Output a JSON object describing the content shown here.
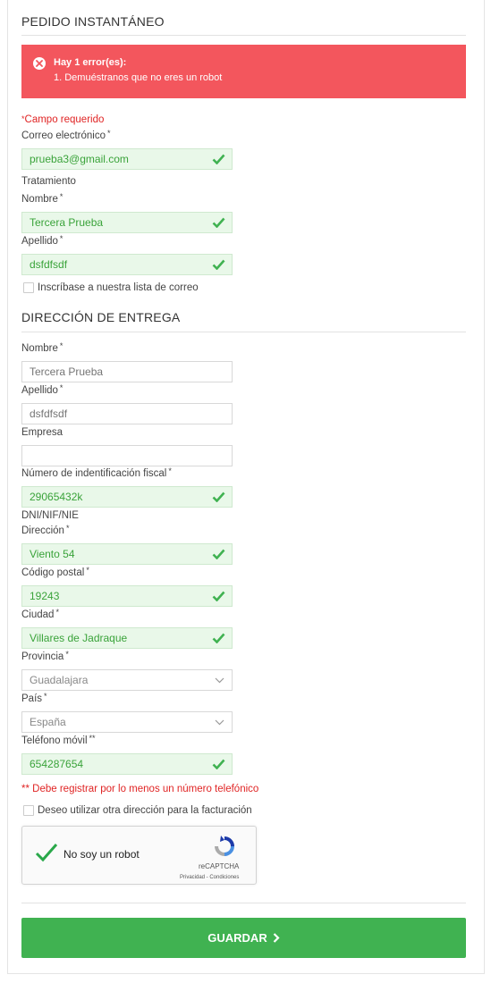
{
  "form": {
    "title": "PEDIDO INSTANTÁNEO",
    "alert": {
      "title": "Hay 1 error(es):",
      "message": "1. Demuéstranos que no eres un robot",
      "color": "#f3565d"
    },
    "required_note": "Campo requerido",
    "email": {
      "label": "Correo electrónico",
      "value": "prueba3@gmail.com"
    },
    "tratamiento_label": "Tratamiento",
    "first_name": {
      "label": "Nombre",
      "value": "Tercera Prueba"
    },
    "last_name": {
      "label": "Apellido",
      "value": "dsfdfsdf"
    },
    "newsletter_label": "Inscríbase a nuestra lista de correo"
  },
  "delivery": {
    "title": "DIRECCIÓN DE ENTREGA",
    "first_name": {
      "label": "Nombre",
      "placeholder": "Tercera Prueba"
    },
    "last_name": {
      "label": "Apellido",
      "placeholder": "dsfdfsdf"
    },
    "company": {
      "label": "Empresa",
      "value": ""
    },
    "tax_id": {
      "label": "Número de indentificación fiscal",
      "value": "29065432k",
      "hint": "DNI/NIF/NIE"
    },
    "address": {
      "label": "Dirección",
      "value": "Viento 54"
    },
    "postal_code": {
      "label": "Código postal",
      "value": "19243"
    },
    "city": {
      "label": "Ciudad",
      "value": "Villares de Jadraque"
    },
    "province": {
      "label": "Provincia",
      "value": "Guadalajara"
    },
    "country": {
      "label": "País",
      "value": "España"
    },
    "mobile": {
      "label": "Teléfono móvil",
      "value": "654287654"
    },
    "phone_note": "Debe registrar por lo menos un número telefónico",
    "billing_label": "Deseo utilizar otra dirección para la facturación"
  },
  "recaptcha": {
    "label": "No soy un robot",
    "brand": "reCAPTCHA",
    "links": "Privacidad - Condiciones"
  },
  "save_button": "GUARDAR",
  "colors": {
    "success": "#40b251",
    "error": "#e02424",
    "valid_bg": "#e9f8e9"
  }
}
